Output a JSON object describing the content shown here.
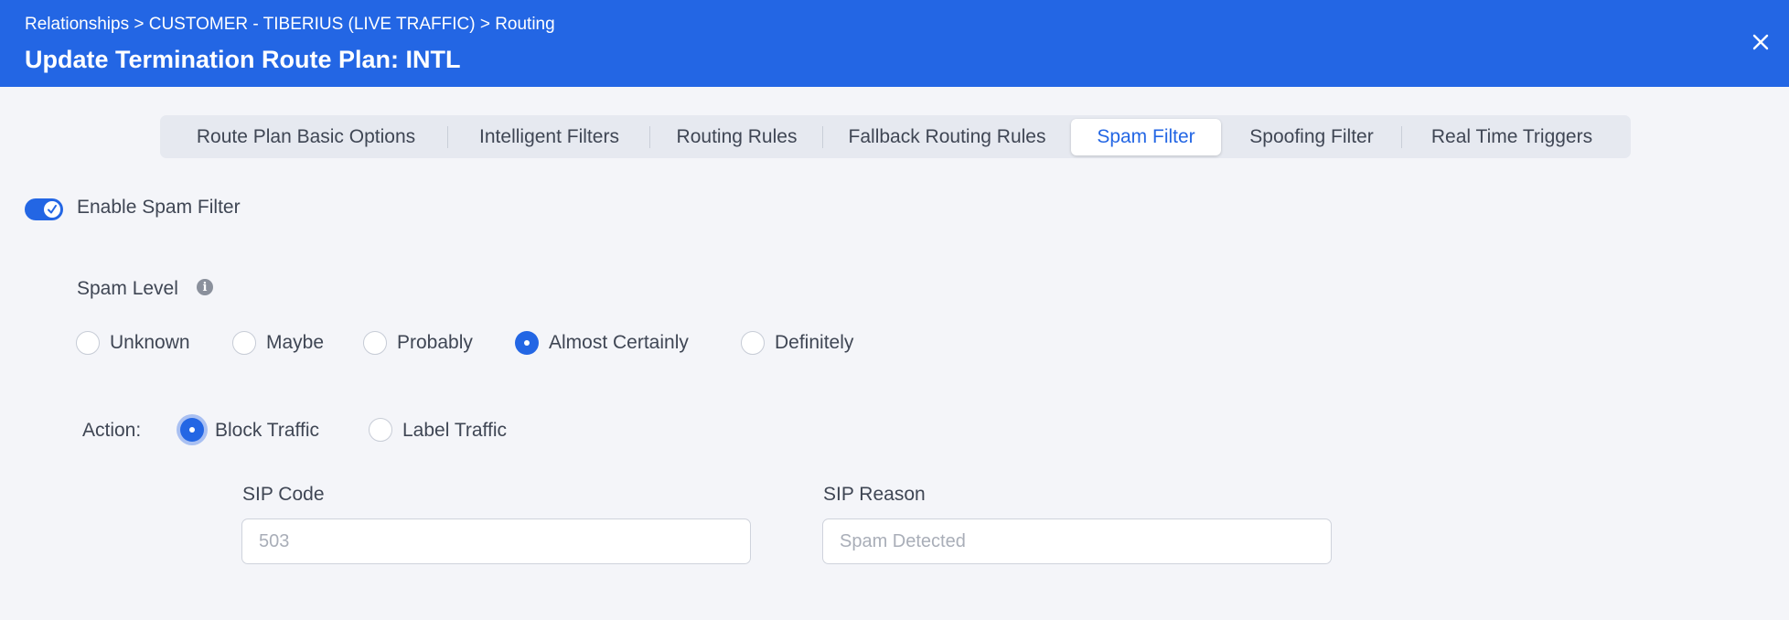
{
  "header": {
    "breadcrumb": "Relationships > CUSTOMER - TIBERIUS (LIVE TRAFFIC) > Routing",
    "title": "Update Termination Route Plan: INTL",
    "background_color": "#2366e4",
    "close_icon": "close-icon"
  },
  "tabs": [
    {
      "label": "Route Plan Basic Options"
    },
    {
      "label": "Intelligent Filters"
    },
    {
      "label": "Routing Rules"
    },
    {
      "label": "Fallback Routing Rules"
    },
    {
      "label": "Spam Filter",
      "active": true
    },
    {
      "label": "Spoofing Filter"
    },
    {
      "label": "Real Time Triggers"
    }
  ],
  "spam_filter": {
    "enable_label": "Enable Spam Filter",
    "enabled": true,
    "level_label": "Spam Level",
    "level_info_icon": "info-icon",
    "levels": [
      {
        "label": "Unknown",
        "selected": false
      },
      {
        "label": "Maybe",
        "selected": false
      },
      {
        "label": "Probably",
        "selected": false
      },
      {
        "label": "Almost Certainly",
        "selected": true
      },
      {
        "label": "Definitely",
        "selected": false
      }
    ],
    "action_label": "Action:",
    "actions": [
      {
        "label": "Block Traffic",
        "selected": true
      },
      {
        "label": "Label Traffic",
        "selected": false
      }
    ],
    "sip_code": {
      "label": "SIP Code",
      "placeholder": "503",
      "value": ""
    },
    "sip_reason": {
      "label": "SIP Reason",
      "placeholder": "Spam Detected",
      "value": ""
    }
  },
  "colors": {
    "accent": "#2366e4",
    "text": "#3f4654",
    "page_background": "#f4f5f9"
  }
}
